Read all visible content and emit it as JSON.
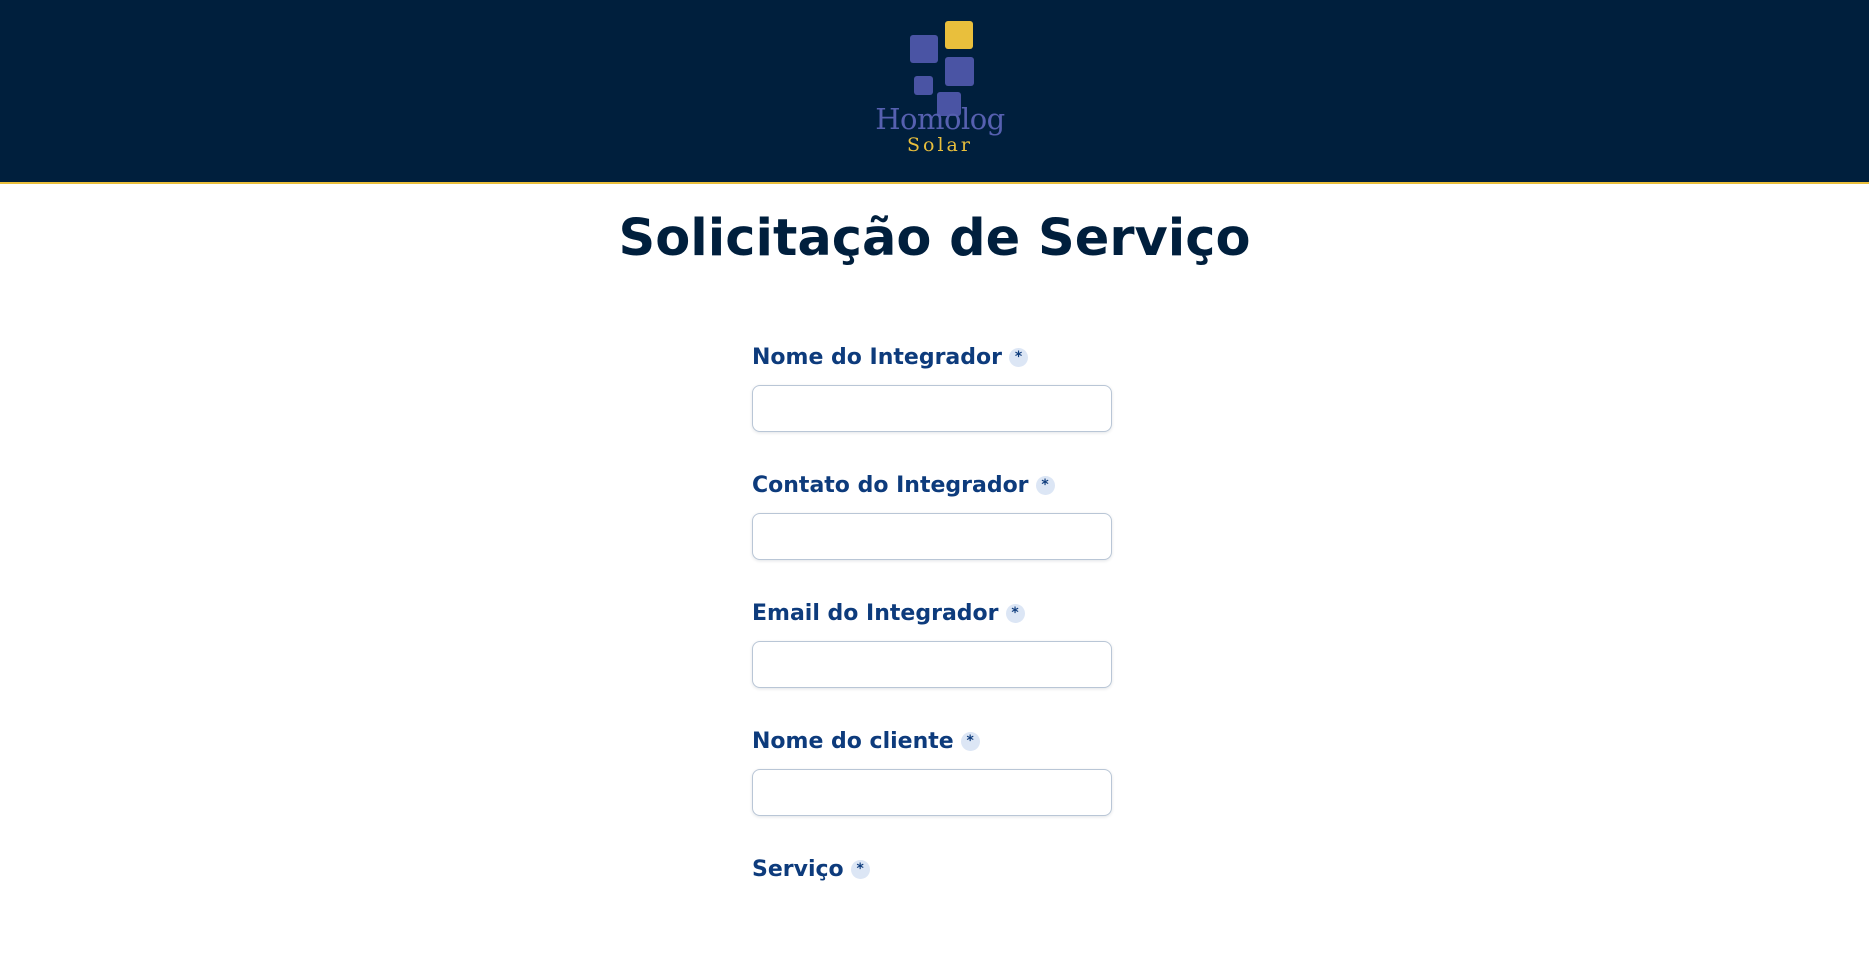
{
  "brand": {
    "name_top": "Homolog",
    "name_bottom": "Solar",
    "colors": {
      "header_bg": "#001f3d",
      "accent_yellow": "#e9bf3c",
      "logo_blue": "#4a54a4",
      "label_blue": "#0d3b7c"
    }
  },
  "page": {
    "title": "Solicitação de Serviço"
  },
  "form": {
    "required_mark": "*",
    "fields": [
      {
        "label": "Nome do Integrador",
        "value": "",
        "placeholder": ""
      },
      {
        "label": "Contato do Integrador",
        "value": "",
        "placeholder": ""
      },
      {
        "label": "Email do Integrador",
        "value": "",
        "placeholder": ""
      },
      {
        "label": "Nome do cliente",
        "value": "",
        "placeholder": ""
      },
      {
        "label": "Serviço"
      }
    ]
  }
}
